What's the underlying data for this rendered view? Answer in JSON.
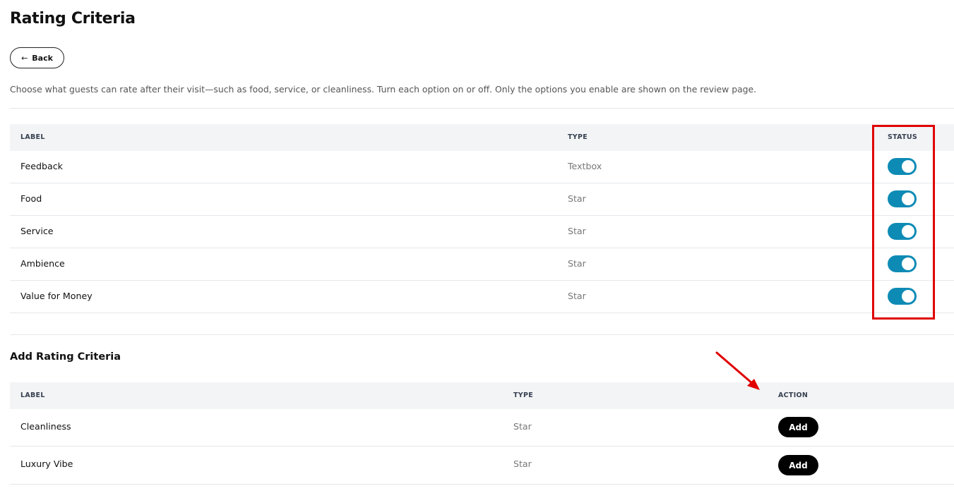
{
  "page": {
    "title": "Rating Criteria",
    "back_label": "Back",
    "back_icon": "arrow-left-icon",
    "description": "Choose what guests can rate after their visit—such as food, service, or cleanliness. Turn each option on or off. Only the options you enable are shown on the review page."
  },
  "criteria_table": {
    "columns": {
      "label": "LABEL",
      "type": "TYPE",
      "status": "STATUS"
    },
    "rows": [
      {
        "label": "Feedback",
        "type": "Textbox",
        "enabled": true
      },
      {
        "label": "Food",
        "type": "Star",
        "enabled": true
      },
      {
        "label": "Service",
        "type": "Star",
        "enabled": true
      },
      {
        "label": "Ambience",
        "type": "Star",
        "enabled": true
      },
      {
        "label": "Value for Money",
        "type": "Star",
        "enabled": true
      }
    ]
  },
  "add_section": {
    "title": "Add Rating Criteria",
    "columns": {
      "label": "LABEL",
      "type": "TYPE",
      "action": "ACTION"
    },
    "rows": [
      {
        "label": "Cleanliness",
        "type": "Star",
        "action_label": "Add"
      },
      {
        "label": "Luxury Vibe",
        "type": "Star",
        "action_label": "Add"
      }
    ]
  },
  "colors": {
    "toggle_on": "#0e8bb5",
    "annotation": "#e00000",
    "header_bg": "#f3f4f6",
    "button_dark": "#000000"
  }
}
